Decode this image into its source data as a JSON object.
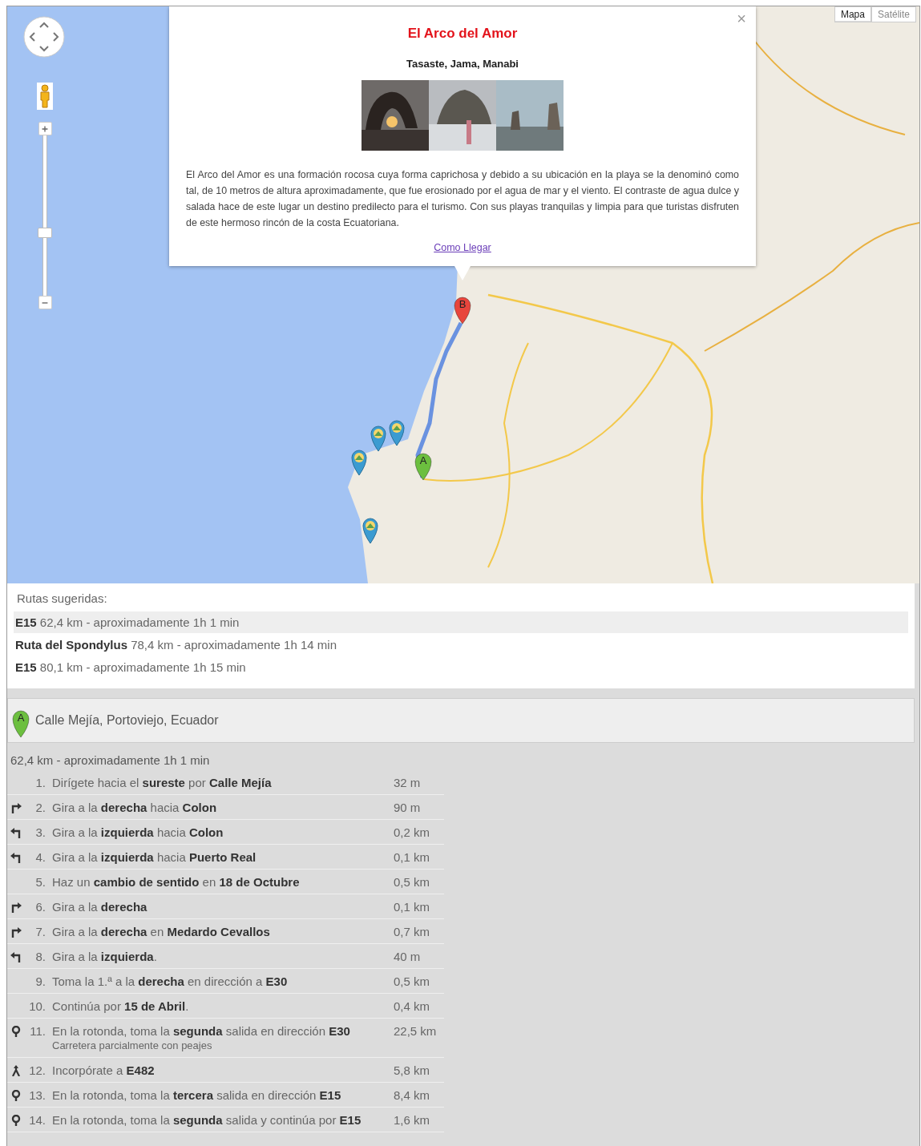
{
  "map": {
    "zoom": {
      "level": 0.39
    },
    "map_types": [
      {
        "label": "Mapa",
        "selected": true
      },
      {
        "label": "Satélite",
        "selected": false
      }
    ],
    "markers": [
      {
        "label": "B",
        "color": "#e8453c"
      },
      {
        "label": "A",
        "color": "#6cbf3f"
      }
    ],
    "popup": {
      "close": "×",
      "title": "El Arco del Amor",
      "subtitle": "Tasaste, Jama, Manabi",
      "description": "El Arco del Amor es una formación rocosa cuya forma caprichosa y debido a su ubicación en la playa se la denominó como tal, de 10 metros de altura aproximadamente, que fue erosionado por el agua de mar y el viento. El contraste de agua dulce y salada hace de este lugar un destino predilecto para el turismo. Con sus playas tranquilas y limpia para que turistas disfruten de este hermoso rincón de la costa Ecuatoriana.",
      "link": "Como Llegar"
    }
  },
  "routes": {
    "heading": "Rutas sugeridas:",
    "items": [
      {
        "name": "E15",
        "detail": "62,4 km - aproximadamente 1h 1 min",
        "selected": true
      },
      {
        "name": "Ruta del Spondylus",
        "detail": "78,4 km - aproximadamente 1h 14 min",
        "selected": false
      },
      {
        "name": "E15",
        "detail": "80,1 km - aproximadamente 1h 15 min",
        "selected": false
      }
    ]
  },
  "start": {
    "marker_label": "A",
    "address": "Calle Mejía, Portoviejo, Ecuador"
  },
  "summary": "62,4 km - aproximadamente 1h 1 min",
  "steps": [
    {
      "kind": "straight",
      "number": "1.",
      "text": "Dirígete hacia el **sureste** por **Calle Mejía**",
      "distance": "32 m"
    },
    {
      "kind": "right",
      "number": "2.",
      "text": "Gira a la **derecha** hacia **Colon**",
      "distance": "90 m"
    },
    {
      "kind": "left",
      "number": "3.",
      "text": "Gira a la **izquierda** hacia **Colon**",
      "distance": "0,2 km"
    },
    {
      "kind": "left",
      "number": "4.",
      "text": "Gira a la **izquierda** hacia **Puerto Real**",
      "distance": "0,1 km"
    },
    {
      "kind": "straight",
      "number": "5.",
      "text": "Haz un **cambio de sentido** en **18 de Octubre**",
      "distance": "0,5 km"
    },
    {
      "kind": "right",
      "number": "6.",
      "text": "Gira a la **derecha**",
      "distance": "0,1 km"
    },
    {
      "kind": "right",
      "number": "7.",
      "text": "Gira a la **derecha** en **Medardo Cevallos**",
      "distance": "0,7 km"
    },
    {
      "kind": "left",
      "number": "8.",
      "text": "Gira a la **izquierda**.",
      "distance": "40 m"
    },
    {
      "kind": "straight",
      "number": "9.",
      "text": "Toma la 1.ª a la **derecha** en dirección a **E30**",
      "distance": "0,5 km"
    },
    {
      "kind": "straight",
      "number": "10.",
      "text": "Continúa por **15 de Abril**.",
      "distance": "0,4 km"
    },
    {
      "kind": "roundabout",
      "number": "11.",
      "text": "En la rotonda, toma la **segunda** salida en dirección **E30**",
      "note": "Carretera parcialmente con peajes",
      "distance": "22,5 km"
    },
    {
      "kind": "merge",
      "number": "12.",
      "text": "Incorpórate a **E482**",
      "distance": "5,8 km"
    },
    {
      "kind": "roundabout",
      "number": "13.",
      "text": "En la rotonda, toma la **tercera** salida en dirección **E15**",
      "distance": "8,4 km"
    },
    {
      "kind": "roundabout",
      "number": "14.",
      "text": "En la rotonda, toma la **segunda** salida y continúa por **E15**",
      "distance": "1,6 km"
    }
  ]
}
